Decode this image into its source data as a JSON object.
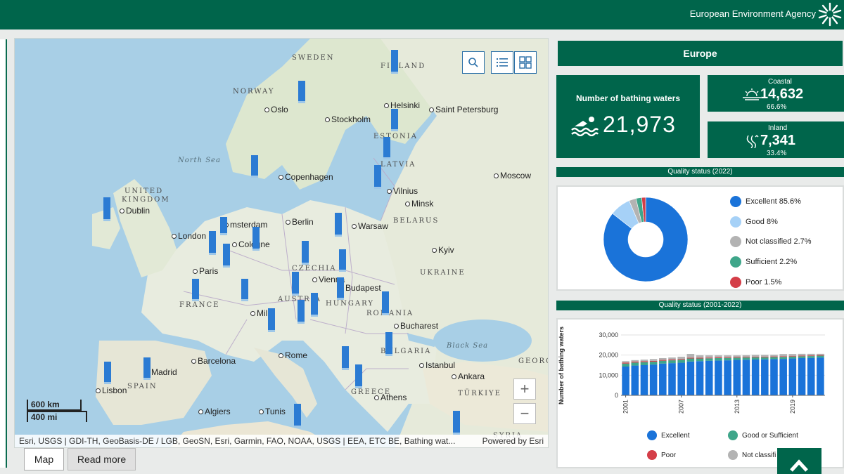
{
  "header": {
    "agency": "European Environment Agency"
  },
  "map": {
    "countries": [
      "SWEDEN",
      "FINLAND",
      "NORWAY",
      "ESTONIA",
      "LATVIA",
      "UNITED",
      "KINGDOM",
      "BELARUS",
      "CZECHIA",
      "UKRAINE",
      "AUSTRIA",
      "HUNGARY",
      "ROMANIA",
      "FRANCE",
      "SPAIN",
      "BULGARIA",
      "GREECE",
      "TÜRKIYE",
      "GEORG",
      "SYRIA"
    ],
    "cities": [
      "Oslo",
      "Helsinki",
      "Saint Petersburg",
      "Stockholm",
      "Copenhagen",
      "Moscow",
      "Vilnius",
      "Minsk",
      "Dublin",
      "Berlin",
      "Warsaw",
      "msterdam",
      "London",
      "Cologne",
      "Kyiv",
      "Paris",
      "Vienna",
      "Budapest",
      "Mil",
      "Bucharest",
      "Barcelona",
      "Rome",
      "Madrid",
      "Istanbul",
      "Ankara",
      "Lisbon",
      "Athens",
      "Algiers",
      "Tunis"
    ],
    "seas": [
      "North Sea",
      "Black Sea"
    ],
    "scale_km": "600 km",
    "scale_mi": "400 mi",
    "attribution": "Esri, USGS | GDI-TH, GeoBasis-DE / LGB, GeoSN, Esri, Garmin, FAO, NOAA, USGS | EEA, ETC BE, Bathing wat...",
    "powered": "Powered by Esri",
    "zoom_in": "+",
    "zoom_out": "−",
    "tools": [
      "search-icon",
      "list-icon",
      "basemap-icon"
    ]
  },
  "tabs": {
    "map": "Map",
    "read_more": "Read more"
  },
  "panel": {
    "region": "Europe",
    "bathing_label": "Number of bathing waters",
    "bathing_total": "21,973",
    "coastal_label": "Coastal",
    "coastal_value": "14,632",
    "coastal_pct": "66.6%",
    "inland_label": "Inland",
    "inland_value": "7,341",
    "inland_pct": "33.4%",
    "quality_title": "Quality status (2022)",
    "trend_title": "Quality status (2001-2022)"
  },
  "donut_legend": [
    {
      "label": "Excellent",
      "pct": "85.6%",
      "color": "#1a73d9"
    },
    {
      "label": "Good",
      "pct": "8%",
      "color": "#a6d1f7"
    },
    {
      "label": "Not classified",
      "pct": "2.7%",
      "color": "#b3b3b3"
    },
    {
      "label": "Sufficient",
      "pct": "2.2%",
      "color": "#3fa68a"
    },
    {
      "label": "Poor",
      "pct": "1.5%",
      "color": "#d43e48"
    }
  ],
  "bar_legend": [
    {
      "label": "Excellent",
      "color": "#1a73d9"
    },
    {
      "label": "Good or Sufficient",
      "color": "#3fa68a"
    },
    {
      "label": "Poor",
      "color": "#d43e48"
    },
    {
      "label": "Not classifi",
      "color": "#b3b3b3"
    }
  ],
  "chart_data": [
    {
      "type": "pie",
      "title": "Quality status (2022)",
      "categories": [
        "Excellent",
        "Good",
        "Not classified",
        "Sufficient",
        "Poor"
      ],
      "values": [
        85.6,
        8,
        2.7,
        2.2,
        1.5
      ]
    },
    {
      "type": "bar",
      "title": "Quality status (2001-2022)",
      "ylabel": "Number of bathing waters",
      "ylim": [
        0,
        30000
      ],
      "yticks": [
        "0",
        "10,000",
        "20,000",
        "30,000"
      ],
      "xticks": [
        "2001",
        "2007",
        "2013",
        "2019"
      ],
      "categories": [
        "2001",
        "2002",
        "2003",
        "2004",
        "2005",
        "2006",
        "2007",
        "2008",
        "2009",
        "2010",
        "2011",
        "2012",
        "2013",
        "2014",
        "2015",
        "2016",
        "2017",
        "2018",
        "2019",
        "2020",
        "2021",
        "2022"
      ],
      "series": [
        {
          "name": "Excellent",
          "values": [
            14300,
            14800,
            15000,
            15300,
            15800,
            16000,
            16200,
            16800,
            17000,
            17200,
            17300,
            17400,
            17600,
            17700,
            17800,
            17900,
            18000,
            18100,
            18300,
            18500,
            18600,
            18800
          ]
        },
        {
          "name": "Good or Sufficient",
          "values": [
            1500,
            1500,
            1500,
            1400,
            1400,
            1400,
            1500,
            1500,
            1300,
            1200,
            1200,
            1200,
            1100,
            1100,
            1100,
            1000,
            1000,
            1000,
            1000,
            900,
            900,
            900
          ]
        },
        {
          "name": "Poor",
          "values": [
            500,
            500,
            450,
            450,
            400,
            400,
            400,
            380,
            380,
            360,
            350,
            350,
            340,
            330,
            330,
            320,
            320,
            320,
            330,
            330,
            330,
            330
          ]
        },
        {
          "name": "Not classified",
          "values": [
            700,
            700,
            800,
            900,
            900,
            1000,
            1100,
            1900,
            1200,
            1100,
            1000,
            900,
            800,
            800,
            900,
            900,
            900,
            1100,
            900,
            900,
            800,
            600
          ]
        }
      ]
    }
  ]
}
